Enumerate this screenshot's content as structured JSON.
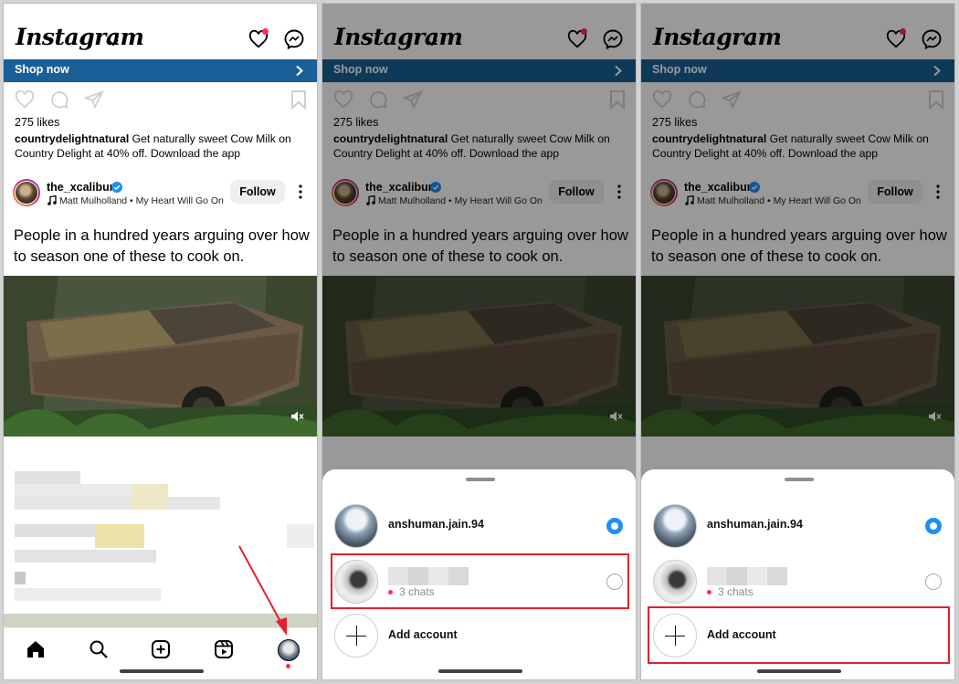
{
  "app": {
    "logo": "Instagram"
  },
  "ad": {
    "shop_label": "Shop now",
    "likes": "275 likes",
    "caption_user": "countrydelightnatural",
    "caption_text": " Get naturally sweet Cow Milk on Country Delight at 40% off. Download the app"
  },
  "post": {
    "author": "the_xcalibur",
    "music": "Matt Mulholland • My Heart Will Go On",
    "follow_label": "Follow",
    "text": "People in a hundred years arguing over how to season one of these to cook on."
  },
  "accounts": {
    "primary_name": "anshuman.jain.94",
    "secondary_chats": "3 chats",
    "add_label": "Add account"
  },
  "colors": {
    "accent_blue": "#1f8ff5",
    "shop_bar": "#1a5f95",
    "highlight_red": "#e3202b",
    "notif_red": "#ff2e50"
  },
  "icons": [
    "chevron-down-icon",
    "heart-icon",
    "messenger-icon",
    "chevron-right-icon",
    "like-icon",
    "comment-icon",
    "share-icon",
    "save-icon",
    "verified-icon",
    "music-note-icon",
    "more-icon",
    "mute-icon",
    "home-icon",
    "search-icon",
    "create-icon",
    "reels-icon",
    "profile-avatar",
    "plus-icon"
  ]
}
